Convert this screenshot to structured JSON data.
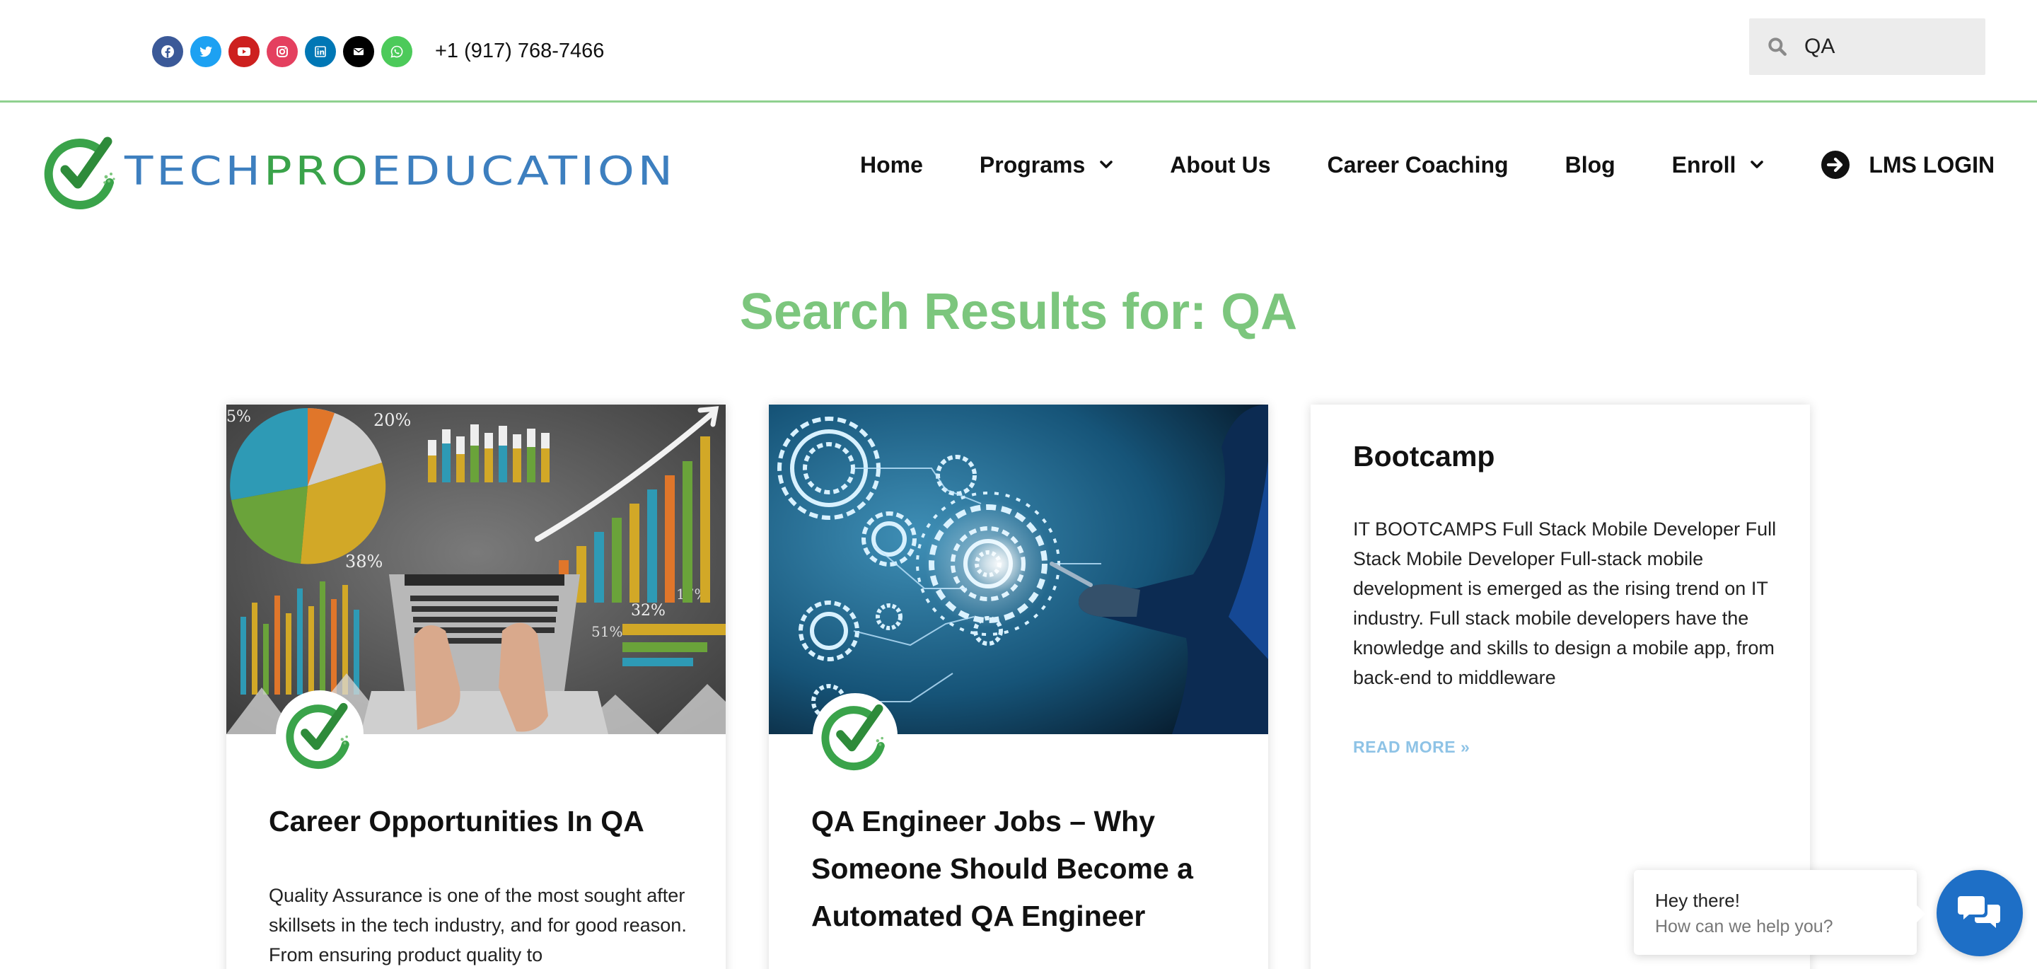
{
  "topbar": {
    "socials": [
      {
        "icon": "facebook-icon",
        "color": "#3b5998"
      },
      {
        "icon": "twitter-icon",
        "color": "#1da1f2"
      },
      {
        "icon": "youtube-icon",
        "color": "#cd201f"
      },
      {
        "icon": "instagram-icon",
        "color": "#e4405f"
      },
      {
        "icon": "linkedin-icon",
        "color": "#0077b5"
      },
      {
        "icon": "envelope-icon",
        "color": "#000000"
      },
      {
        "icon": "whatsapp-icon",
        "color": "#4cca5a"
      }
    ],
    "phone": "+1 (917) 768-7466",
    "search_value": "QA"
  },
  "logo": {
    "part1": "TECH",
    "part2": "PRO",
    "part3": "EDUCATION"
  },
  "nav": {
    "items": [
      {
        "label": "Home",
        "dropdown": false
      },
      {
        "label": "Programs",
        "dropdown": true
      },
      {
        "label": "About Us",
        "dropdown": false
      },
      {
        "label": "Career Coaching",
        "dropdown": false
      },
      {
        "label": "Blog",
        "dropdown": false
      },
      {
        "label": "Enroll",
        "dropdown": true
      }
    ],
    "lms_label": "LMS LOGIN"
  },
  "page_title": "Search Results for: QA",
  "cards": [
    {
      "title": "Career Opportunities In QA",
      "excerpt": "Quality Assurance is one of the most sought after skillsets in the tech industry, and for good reason. From ensuring product quality to"
    },
    {
      "title": "QA Engineer Jobs – Why Someone Should Become a Automated QA Engineer"
    },
    {
      "title": "Bootcamp",
      "excerpt": "IT BOOTCAMPS Full Stack Mobile Developer Full Stack Mobile Developer Full-stack mobile development is emerged as the rising trend on IT industry. Full stack mobile developers have the knowledge and skills to design a mobile app, from back-end to middleware",
      "read_more": "READ MORE »"
    }
  ],
  "chart_image_labels": [
    "5%",
    "20%",
    "38%",
    "32%",
    "17%",
    "51%"
  ],
  "chat": {
    "greeting": "Hey there!",
    "prompt": "How can we help you?"
  },
  "colors": {
    "accent_green": "#7cc67d",
    "logo_blue": "#3d7fbf",
    "logo_green": "#3aa34a",
    "read_more_blue": "#8ec3e6",
    "chat_blue": "#1e6fc6"
  }
}
